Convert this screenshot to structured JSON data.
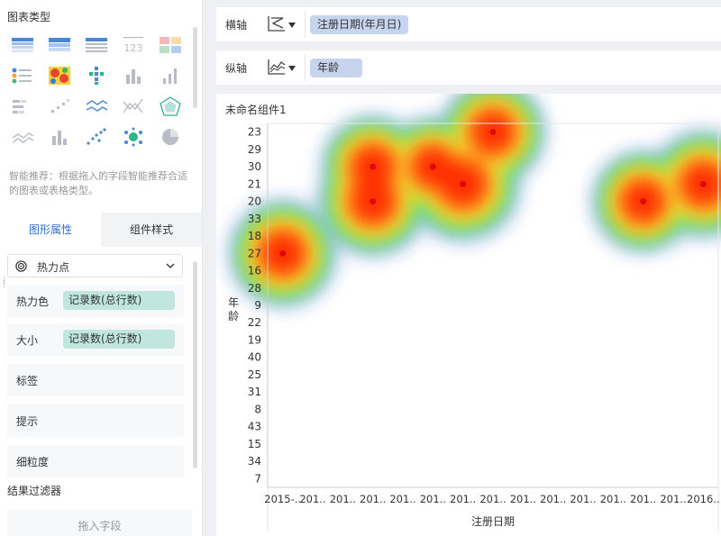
{
  "left_panel": {
    "chart_types_title": "图表类型",
    "chart_type_icons": [
      "cross-table-icon",
      "grouped-table-icon",
      "detail-table-icon",
      "kpi-number-icon",
      "kpi-card-icon",
      "list-chart-icon",
      "heatmap-icon",
      "dot-matrix-icon",
      "bar-chart-icon",
      "column-chart-icon",
      "stacked-bar-icon",
      "step-column-icon",
      "line-chart-icon",
      "crossing-line-icon",
      "radar-chart-icon",
      "area-chart-icon",
      "box-chart-icon",
      "scatter-chart-icon",
      "bubble-chart-icon",
      "pie-chart-icon"
    ],
    "recommend_text": "智能推荐：根据拖入的字段智能推荐合适的图表或表格类型。",
    "tabs": {
      "active": "图形属性",
      "inactive": "组件样式"
    },
    "mark_type": {
      "label": "热力点"
    },
    "properties": [
      {
        "label": "热力色",
        "field": "记录数(总行数)"
      },
      {
        "label": "大小",
        "field": "记录数(总行数)"
      },
      {
        "label": "标签"
      },
      {
        "label": "提示"
      },
      {
        "label": "细粒度"
      }
    ],
    "filter": {
      "title": "结果过滤器",
      "placeholder": "拖入字段"
    }
  },
  "x_axis": {
    "label": "横轴",
    "field": "注册日期(年月日)"
  },
  "y_axis": {
    "label": "纵轴",
    "field": "年龄"
  },
  "component_title": "未命名组件1",
  "colors": {
    "accent": "#2f6fd1",
    "x_pill": "#c6d4ee",
    "y_pill": "#c6d4ee",
    "measure_pill": "#bfe6df"
  },
  "chart_data": {
    "type": "heatmap",
    "title": "",
    "xlabel": "注册日期",
    "ylabel": "年龄",
    "x_tick_labels": [
      "2015-..",
      "201..",
      "201..",
      "201..",
      "201..",
      "201..",
      "201..",
      "201..",
      "201..",
      "201..",
      "201..",
      "201..",
      "201..",
      "201..",
      "2016.."
    ],
    "y_tick_labels": [
      "23",
      "29",
      "30",
      "21",
      "20",
      "33",
      "18",
      "27",
      "16",
      "28",
      "9",
      "22",
      "19",
      "40",
      "25",
      "31",
      "8",
      "43",
      "15",
      "34",
      "7"
    ],
    "hotspots": [
      {
        "x": "2015-..",
        "y": "27",
        "intensity": 0.85
      },
      {
        "x": "201..",
        "y": "30",
        "intensity": 0.75,
        "x_index": 3
      },
      {
        "x": "201..",
        "y": "20",
        "intensity": 0.9,
        "x_index": 3
      },
      {
        "x": "201..",
        "y": "30",
        "intensity": 0.7,
        "x_index": 5
      },
      {
        "x": "201..",
        "y": "21",
        "intensity": 1.0,
        "x_index": 6
      },
      {
        "x": "201..",
        "y": "23",
        "intensity": 0.8,
        "x_index": 7
      },
      {
        "x": "201..",
        "y": "20",
        "intensity": 0.75,
        "x_index": 12
      },
      {
        "x": "2016..",
        "y": "21",
        "intensity": 0.85
      }
    ],
    "grid": false,
    "legend": "none"
  }
}
